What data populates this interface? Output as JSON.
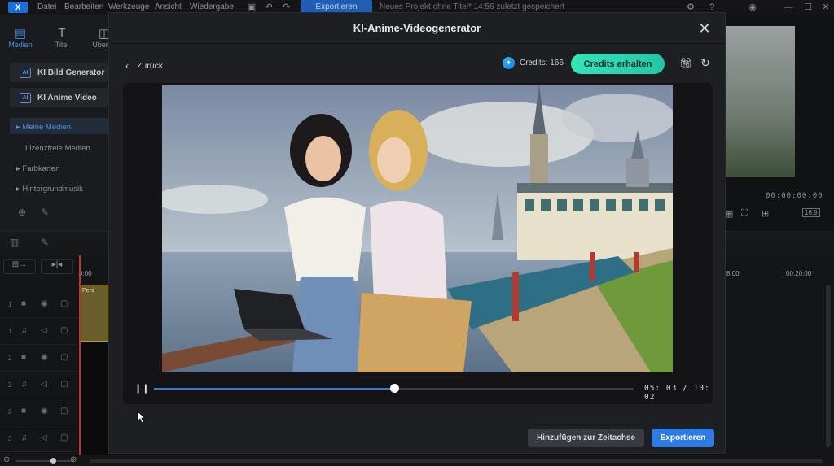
{
  "app": {
    "menu": [
      "Datei",
      "Bearbeiten",
      "Werkzeuge",
      "Ansicht",
      "Wiedergabe"
    ],
    "export_tab": "Exportieren",
    "project_title": "Neues Projekt ohne Titel*",
    "saved_status": "14:56 zuletzt gespeichert"
  },
  "left_panel": {
    "tabs": [
      {
        "label": "Medien",
        "icon": "media-icon"
      },
      {
        "label": "Titel",
        "icon": "title-icon"
      },
      {
        "label": "Über",
        "icon": "transition-icon"
      }
    ],
    "ai_buttons": [
      "KI Bild Generator",
      "KI Anime Video"
    ],
    "media_items": [
      "Meine Medien",
      "Lizenzfreie Medien",
      "Farbkarten",
      "Hintergrundmusik"
    ]
  },
  "timeline": {
    "time_start": "0:00",
    "ticks": [
      "8:00",
      "00:20:00"
    ],
    "clip_label": "Pers",
    "track_numbers": [
      "1",
      "1",
      "2",
      "2",
      "3",
      "3"
    ]
  },
  "right_panel": {
    "timecode": "00:00:00:00",
    "ratio": "16:9"
  },
  "modal": {
    "title": "KI-Anime-Videogenerator",
    "back_label": "Zurück",
    "credits_label": "Credits: 166",
    "credits_button": "Credits erhalten",
    "time_display": "05: 03 / 10: 02",
    "progress": 0.5,
    "add_button": "Hinzufügen zur Zeitachse",
    "export_button": "Exportieren"
  },
  "colors": {
    "accent": "#2f7be6",
    "credits": "#37e3b7",
    "bg": "#1e1f22"
  }
}
